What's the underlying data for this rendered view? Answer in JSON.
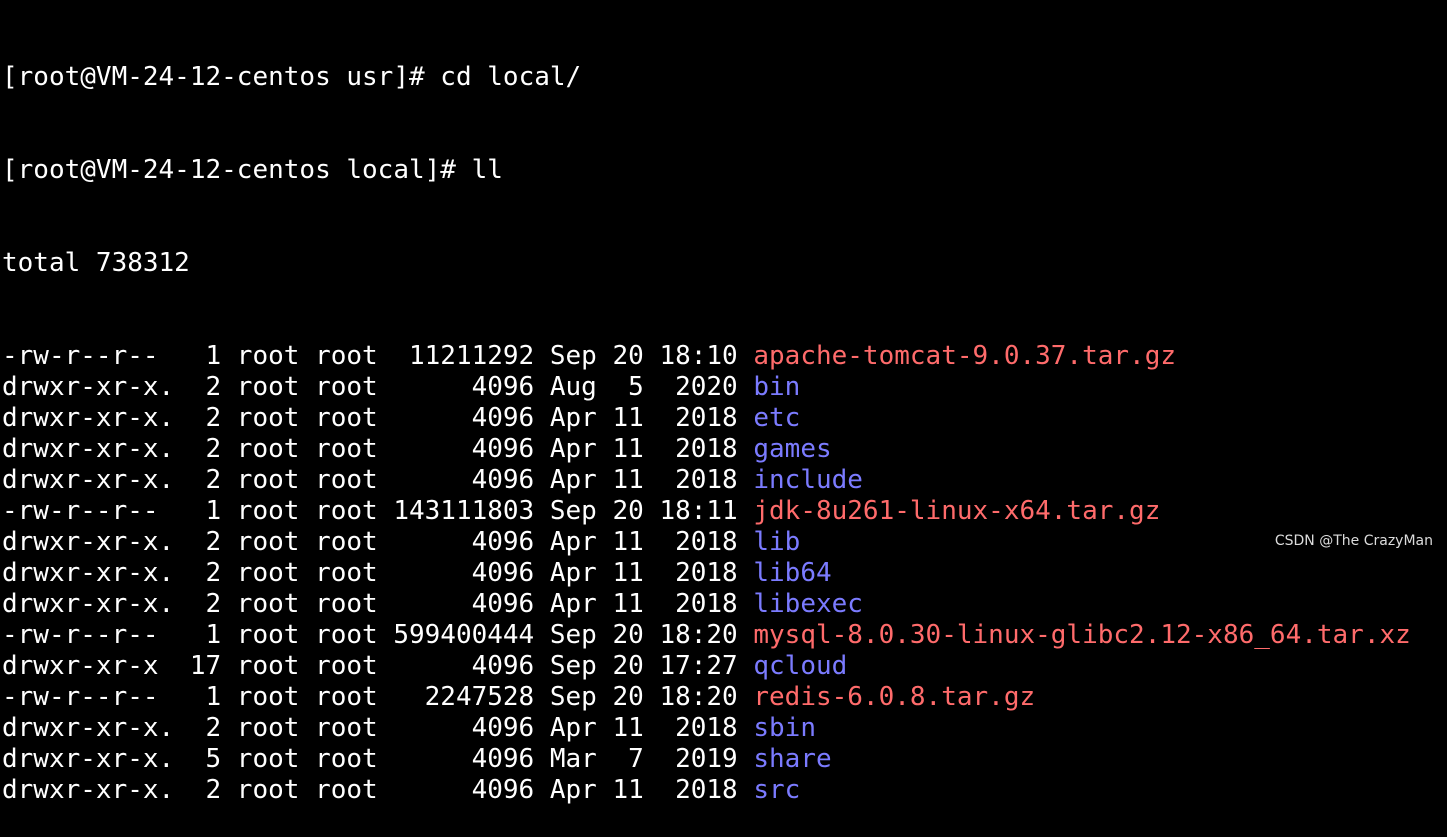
{
  "prompt_lines": [
    {
      "prompt": "[root@VM-24-12-centos usr]# ",
      "command": "cd local/"
    },
    {
      "prompt": "[root@VM-24-12-centos local]# ",
      "command": "ll"
    }
  ],
  "total_line": "total 738312",
  "colors": {
    "background": "#000000",
    "text": "#ffffff",
    "directory": "#7b7bff",
    "archive": "#ff6b6b"
  },
  "entries": [
    {
      "meta": "-rw-r--r--   1 root root  11211292 Sep 20 18:10 ",
      "name": "apache-tomcat-9.0.37.tar.gz",
      "kind": "archive"
    },
    {
      "meta": "drwxr-xr-x.  2 root root      4096 Aug  5  2020 ",
      "name": "bin",
      "kind": "directory"
    },
    {
      "meta": "drwxr-xr-x.  2 root root      4096 Apr 11  2018 ",
      "name": "etc",
      "kind": "directory"
    },
    {
      "meta": "drwxr-xr-x.  2 root root      4096 Apr 11  2018 ",
      "name": "games",
      "kind": "directory"
    },
    {
      "meta": "drwxr-xr-x.  2 root root      4096 Apr 11  2018 ",
      "name": "include",
      "kind": "directory"
    },
    {
      "meta": "-rw-r--r--   1 root root 143111803 Sep 20 18:11 ",
      "name": "jdk-8u261-linux-x64.tar.gz",
      "kind": "archive"
    },
    {
      "meta": "drwxr-xr-x.  2 root root      4096 Apr 11  2018 ",
      "name": "lib",
      "kind": "directory"
    },
    {
      "meta": "drwxr-xr-x.  2 root root      4096 Apr 11  2018 ",
      "name": "lib64",
      "kind": "directory"
    },
    {
      "meta": "drwxr-xr-x.  2 root root      4096 Apr 11  2018 ",
      "name": "libexec",
      "kind": "directory"
    },
    {
      "meta": "-rw-r--r--   1 root root 599400444 Sep 20 18:20 ",
      "name": "mysql-8.0.30-linux-glibc2.12-x86_64.tar.xz",
      "kind": "archive"
    },
    {
      "meta": "drwxr-xr-x  17 root root      4096 Sep 20 17:27 ",
      "name": "qcloud",
      "kind": "directory"
    },
    {
      "meta": "-rw-r--r--   1 root root   2247528 Sep 20 18:20 ",
      "name": "redis-6.0.8.tar.gz",
      "kind": "archive"
    },
    {
      "meta": "drwxr-xr-x.  2 root root      4096 Apr 11  2018 ",
      "name": "sbin",
      "kind": "directory"
    },
    {
      "meta": "drwxr-xr-x.  5 root root      4096 Mar  7  2019 ",
      "name": "share",
      "kind": "directory"
    },
    {
      "meta": "drwxr-xr-x.  2 root root      4096 Apr 11  2018 ",
      "name": "src",
      "kind": "directory"
    }
  ],
  "watermark": "CSDN @The CrazyMan"
}
